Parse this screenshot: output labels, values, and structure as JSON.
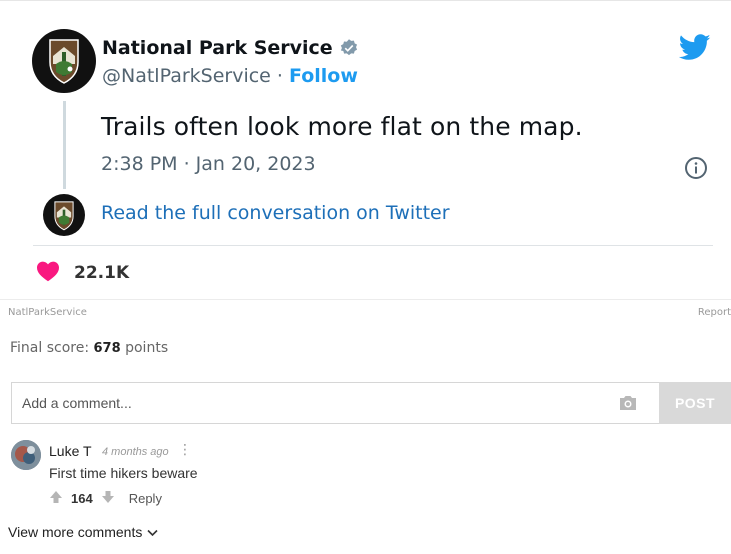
{
  "tweet": {
    "author_name": "National Park Service",
    "handle": "@NatlParkService",
    "separator": " · ",
    "follow_label": "Follow",
    "text": "Trails often look more flat on the map.",
    "timestamp": "2:38 PM · Jan 20, 2023",
    "read_link": "Read the full conversation on Twitter",
    "like_count": "22.1K",
    "colors": {
      "accent": "#1d9bf0",
      "heart": "#f91880"
    }
  },
  "post_meta": {
    "source": "NatlParkService",
    "report": "Report",
    "final_score_label": "Final score:",
    "final_score_value": "678",
    "points_label": "points"
  },
  "comment_box": {
    "placeholder": "Add a comment...",
    "post_label": "POST"
  },
  "comment": {
    "username": "Luke T",
    "time": "4 months ago",
    "more": "⋮",
    "text": "First time hikers beware",
    "votes": "164",
    "reply_label": "Reply"
  },
  "view_more_label": "View more comments"
}
